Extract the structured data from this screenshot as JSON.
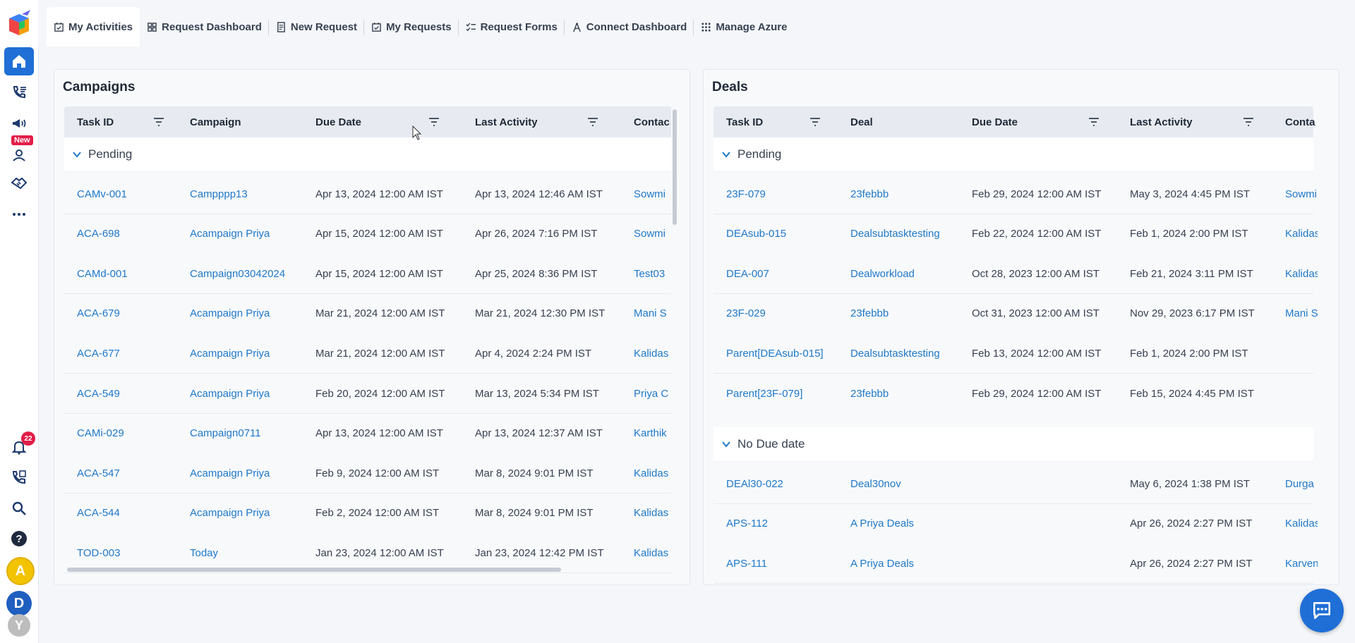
{
  "nav": {
    "tabs": [
      {
        "label": "My Activities",
        "icon": "calendar-check-icon",
        "active": true
      },
      {
        "label": "Request Dashboard",
        "icon": "dashboard-grid-icon"
      },
      {
        "label": "New Request",
        "icon": "document-icon"
      },
      {
        "label": "My Requests",
        "icon": "calendar-check-icon"
      },
      {
        "label": "Request Forms",
        "icon": "checklist-icon"
      },
      {
        "label": "Connect Dashboard",
        "icon": "tower-icon"
      },
      {
        "label": "Manage Azure",
        "icon": "apps-grid-icon"
      }
    ]
  },
  "sidebar": {
    "new_badge": "New",
    "notification_count": "22",
    "avatars": [
      "A",
      "D",
      "Y"
    ],
    "colors": {
      "avatar_a": "#f2c300",
      "avatar_d": "#1f5fbf",
      "avatar_y": "#bdbdbd",
      "accent": "#1f6fd6"
    }
  },
  "campaigns": {
    "title": "Campaigns",
    "columns": [
      "Task ID",
      "Campaign",
      "Due Date",
      "Last Activity",
      "Contac"
    ],
    "group": "Pending",
    "rows": [
      {
        "task_id": "CAMv-001",
        "name": "Campppp13",
        "due": "Apr 13, 2024 12:00 AM IST",
        "last": "Apr 13, 2024 12:46 AM IST",
        "contact": "Sowmi"
      },
      {
        "task_id": "ACA-698",
        "name": "Acampaign Priya",
        "due": "Apr 15, 2024 12:00 AM IST",
        "last": "Apr 26, 2024 7:16 PM IST",
        "contact": "Sowmi"
      },
      {
        "task_id": "CAMd-001",
        "name": "Campaign03042024",
        "due": "Apr 15, 2024 12:00 AM IST",
        "last": "Apr 25, 2024 8:36 PM IST",
        "contact": "Test03"
      },
      {
        "task_id": "ACA-679",
        "name": "Acampaign Priya",
        "due": "Mar 21, 2024 12:00 AM IST",
        "last": "Mar 21, 2024 12:30 PM IST",
        "contact": "Mani S"
      },
      {
        "task_id": "ACA-677",
        "name": "Acampaign Priya",
        "due": "Mar 21, 2024 12:00 AM IST",
        "last": "Apr 4, 2024 2:24 PM IST",
        "contact": "Kalidas"
      },
      {
        "task_id": "ACA-549",
        "name": "Acampaign Priya",
        "due": "Feb 20, 2024 12:00 AM IST",
        "last": "Mar 13, 2024 5:34 PM IST",
        "contact": "Priya C"
      },
      {
        "task_id": "CAMi-029",
        "name": "Campaign0711",
        "due": "Apr 13, 2024 12:00 AM IST",
        "last": "Apr 13, 2024 12:37 AM IST",
        "contact": "Karthik"
      },
      {
        "task_id": "ACA-547",
        "name": "Acampaign Priya",
        "due": "Feb 9, 2024 12:00 AM IST",
        "last": "Mar 8, 2024 9:01 PM IST",
        "contact": "Kalidas"
      },
      {
        "task_id": "ACA-544",
        "name": "Acampaign Priya",
        "due": "Feb 2, 2024 12:00 AM IST",
        "last": "Mar 8, 2024 9:01 PM IST",
        "contact": "Kalidas"
      },
      {
        "task_id": "TOD-003",
        "name": "Today",
        "due": "Jan 23, 2024 12:00 AM IST",
        "last": "Jan 23, 2024 12:42 PM IST",
        "contact": "Kalidas"
      }
    ]
  },
  "deals": {
    "title": "Deals",
    "columns": [
      "Task ID",
      "Deal",
      "Due Date",
      "Last Activity",
      "Conta"
    ],
    "group_pending": "Pending",
    "pending_rows": [
      {
        "task_id": "23F-079",
        "name": "23febbb",
        "due": "Feb 29, 2024 12:00 AM IST",
        "last": "May 3, 2024 4:45 PM IST",
        "contact": "Sowmi"
      },
      {
        "task_id": "DEAsub-015",
        "name": "Dealsubtasktesting",
        "due": "Feb 22, 2024 12:00 AM IST",
        "last": "Feb 1, 2024 2:00 PM IST",
        "contact": "Kalidas"
      },
      {
        "task_id": "DEA-007",
        "name": "Dealworkload",
        "due": "Oct 28, 2023 12:00 AM IST",
        "last": "Feb 21, 2024 3:11 PM IST",
        "contact": "Kalidas"
      },
      {
        "task_id": "23F-029",
        "name": "23febbb",
        "due": "Oct 31, 2023 12:00 AM IST",
        "last": "Nov 29, 2023 6:17 PM IST",
        "contact": "Mani S"
      },
      {
        "task_id": "Parent[DEAsub-015]",
        "name": "Dealsubtasktesting",
        "due": "Feb 13, 2024 12:00 AM IST",
        "last": "Feb 1, 2024 2:00 PM IST",
        "contact": ""
      },
      {
        "task_id": "Parent[23F-079]",
        "name": "23febbb",
        "due": "Feb 29, 2024 12:00 AM IST",
        "last": "Feb 15, 2024 4:45 PM IST",
        "contact": ""
      }
    ],
    "group_nodue": "No Due date",
    "nodue_rows": [
      {
        "task_id": "DEAl30-022",
        "name": "Deal30nov",
        "due": "",
        "last": "May 6, 2024 1:38 PM IST",
        "contact": "Durga"
      },
      {
        "task_id": "APS-112",
        "name": "A Priya Deals",
        "due": "",
        "last": "Apr 26, 2024 2:27 PM IST",
        "contact": "Kalidas"
      },
      {
        "task_id": "APS-111",
        "name": "A Priya Deals",
        "due": "",
        "last": "Apr 26, 2024 2:27 PM IST",
        "contact": "Karven"
      }
    ]
  }
}
